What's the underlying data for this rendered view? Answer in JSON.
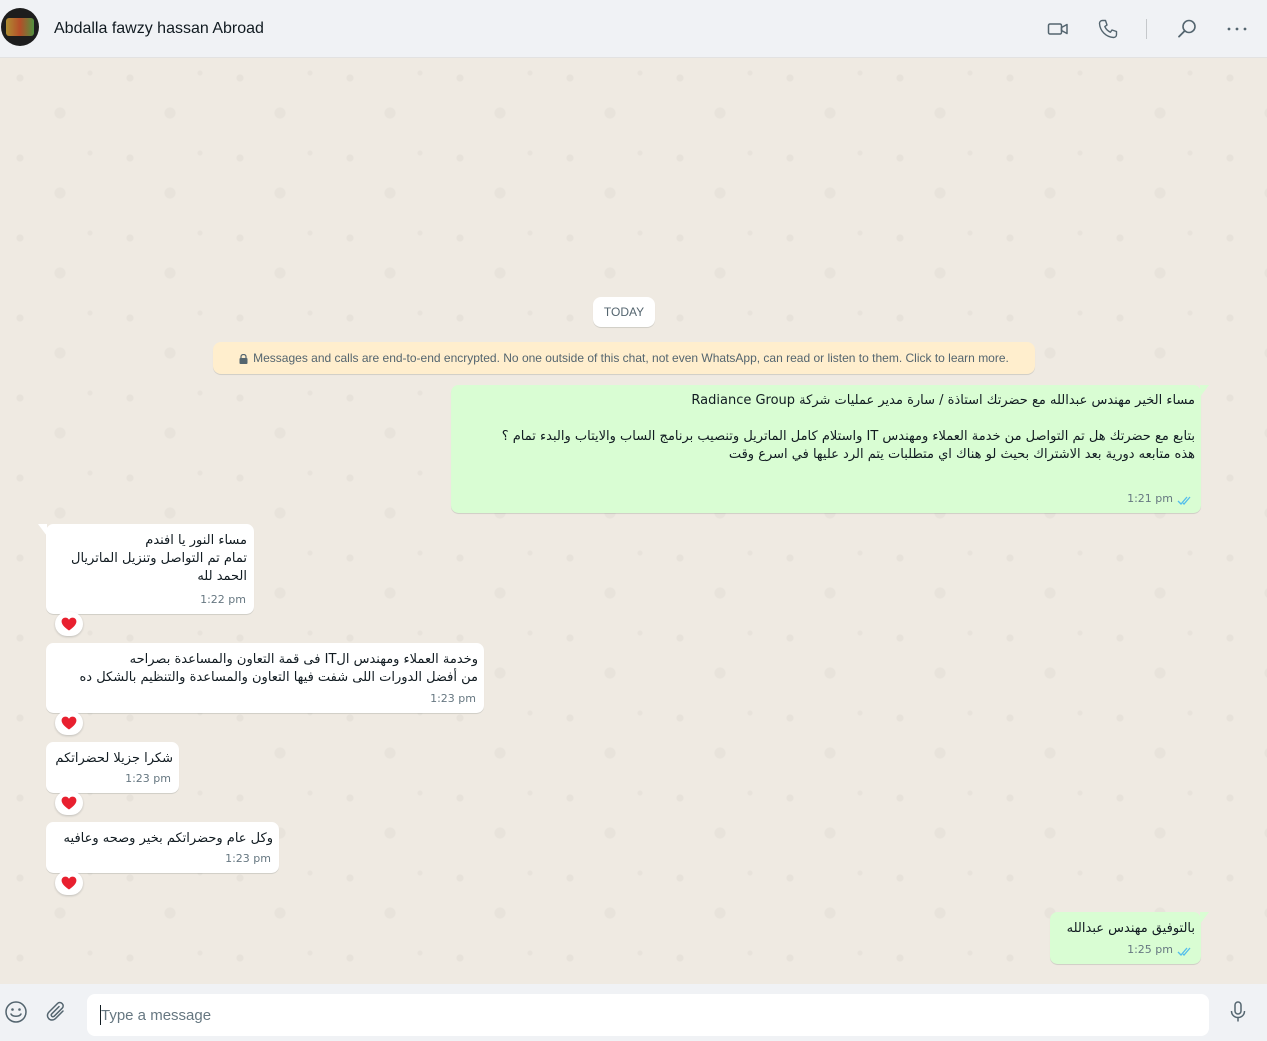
{
  "header": {
    "contact_name": "Abdalla fawzy hassan Abroad",
    "icons": [
      "video-call-icon",
      "voice-call-icon",
      "search-icon",
      "menu-icon"
    ]
  },
  "chat": {
    "date_label": "TODAY",
    "encryption_notice": "Messages and calls are end-to-end encrypted. No one outside of this chat, not even WhatsApp, can read or listen to them. Click to learn more.",
    "messages": [
      {
        "direction": "outgoing",
        "text": "مساء الخير مهندس عبدالله مع حضرتك استاذة / سارة مدير عمليات شركة Radiance Group\n\nبتابع مع حضرتك هل تم التواصل من خدمة العملاء ومهندس IT واستلام كامل الماتريل وتنصيب برنامج الساب والايتاب والبدء تمام ؟\nهذه متابعه دورية بعد الاشتراك بحيث لو هناك اي متطلبات يتم الرد عليها في اسرع وقت",
        "time": "1:21 pm",
        "status": "read"
      },
      {
        "direction": "incoming",
        "text": "مساء النور يا افندم\nتمام تم التواصل وتنزيل الماتريال\nالحمد لله",
        "time": "1:22 pm",
        "reaction": "❤️"
      },
      {
        "direction": "incoming",
        "text": "وخدمة العملاء ومهندس الIT فى قمة التعاون والمساعدة بصراحه\nمن أفضل الدورات اللى شفت فيها التعاون والمساعدة والتنظيم بالشكل ده",
        "time": "1:23 pm",
        "reaction": "❤️"
      },
      {
        "direction": "incoming",
        "text": "شكرا جزيلا لحضراتكم",
        "time": "1:23 pm",
        "reaction": "❤️"
      },
      {
        "direction": "incoming",
        "text": "وكل عام وحضراتكم بخير وصحه وعافيه",
        "time": "1:23 pm",
        "reaction": "❤️"
      },
      {
        "direction": "outgoing",
        "text": "بالتوفيق مهندس عبدالله",
        "time": "1:25 pm",
        "status": "read"
      }
    ]
  },
  "composer": {
    "placeholder": "Type a message",
    "value": ""
  },
  "colors": {
    "outgoing_bubble": "#d9fdd3",
    "incoming_bubble": "#ffffff",
    "read_ticks": "#53bdeb",
    "notice_bg": "#ffeecd",
    "reaction_heart": "#e8202f"
  }
}
